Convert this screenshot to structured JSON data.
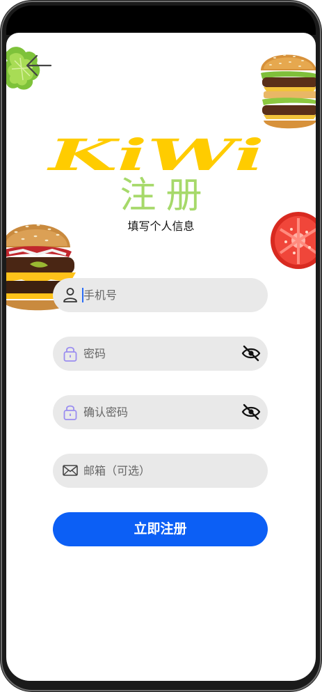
{
  "app": {
    "logo_text": "KiWi",
    "title": "注册",
    "subtitle": "填写个人信息"
  },
  "form": {
    "phone_placeholder": "手机号",
    "password_placeholder": "密码",
    "confirm_password_placeholder": "确认密码",
    "email_placeholder": "邮箱（可选）",
    "submit_label": "立即注册"
  },
  "icons": {
    "back": "arrow-left-icon",
    "phone": "user-icon",
    "password": "lock-icon",
    "confirm_password": "lock-icon",
    "email": "mail-icon",
    "toggle_visibility": "eye-off-icon"
  },
  "colors": {
    "title_green": "#a6d96a",
    "logo_yellow": "#ffcc00",
    "primary_button": "#0c5ff5",
    "field_bg": "#e9e9e9"
  }
}
